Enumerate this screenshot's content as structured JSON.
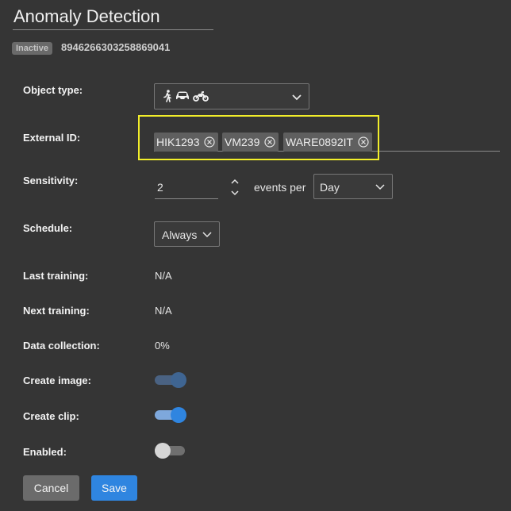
{
  "header": {
    "title": "Anomaly Detection",
    "status_badge": "Inactive",
    "device_id": "8946266303258869041"
  },
  "form": {
    "object_type": {
      "label": "Object type:",
      "icons": [
        "pedestrian-icon",
        "car-icon",
        "motorcycle-icon"
      ]
    },
    "external_id": {
      "label": "External ID:",
      "chips": [
        "HIK1293",
        "VM239",
        "WARE0892IT"
      ]
    },
    "sensitivity": {
      "label": "Sensitivity:",
      "value": "2",
      "events_per_label": "events per",
      "period": "Day"
    },
    "schedule": {
      "label": "Schedule:",
      "value": "Always"
    },
    "last_training": {
      "label": "Last training:",
      "value": "N/A"
    },
    "next_training": {
      "label": "Next training:",
      "value": "N/A"
    },
    "data_collection": {
      "label": "Data collection:",
      "value": "0%"
    },
    "create_image": {
      "label": "Create image:",
      "enabled": true,
      "dimmed": true
    },
    "create_clip": {
      "label": "Create clip:",
      "enabled": true,
      "dimmed": false
    },
    "enabled": {
      "label": "Enabled:",
      "enabled": false
    }
  },
  "buttons": {
    "cancel": "Cancel",
    "save": "Save"
  },
  "colors": {
    "background": "#353535",
    "accent": "#2f85e0",
    "highlight": "#f2ee2a"
  }
}
